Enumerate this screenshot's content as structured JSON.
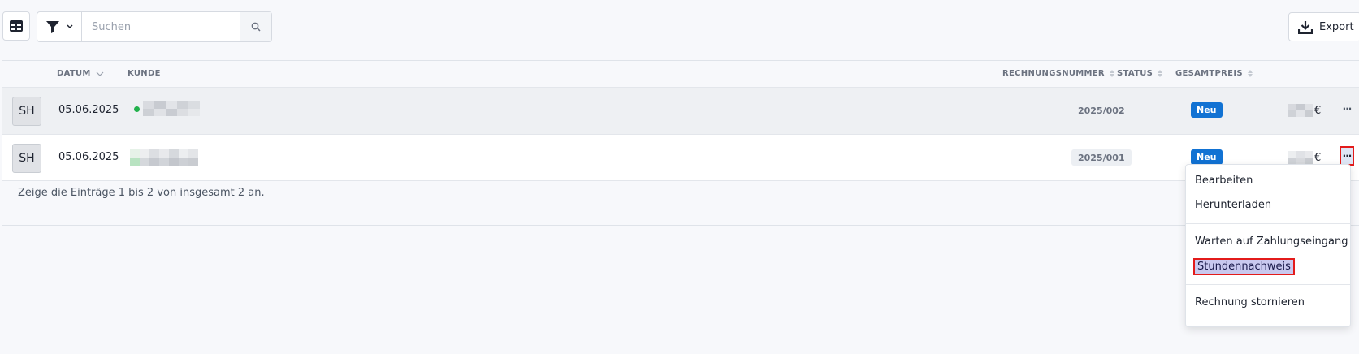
{
  "toolbar": {
    "view_icon": "table-icon",
    "filter_icon": "filter-icon",
    "search_placeholder": "Suchen",
    "search_value": "",
    "search_icon": "search-icon",
    "export_label": "Export",
    "export_icon": "download-icon"
  },
  "table": {
    "columns": [
      {
        "label": "DATUM",
        "sort": "chevron-down-icon"
      },
      {
        "label": "KUNDE"
      },
      {
        "label": "RECHNUNGSNUMMER",
        "sort": "sort-icon"
      },
      {
        "label": "STATUS",
        "sort": "sort-icon"
      },
      {
        "label": "GESAMTPREIS",
        "sort": "sort-icon"
      }
    ],
    "rows": [
      {
        "avatar": "SH",
        "date": "05.06.2025",
        "invoice": "2025/002",
        "status": "Neu",
        "price_suffix": "€",
        "more": "···"
      },
      {
        "avatar": "SH",
        "date": "05.06.2025",
        "invoice": "2025/001",
        "status": "Neu",
        "price_suffix": "€",
        "more": "···"
      }
    ],
    "footer": "Zeige die Einträge 1 bis 2 von insgesamt 2 an."
  },
  "dropdown": {
    "items": [
      "Bearbeiten",
      "Herunterladen",
      "Warten auf Zahlungseingang",
      "Stundennachweis",
      "Rechnung stornieren"
    ]
  },
  "colors": {
    "status_badge": "#1172d3",
    "highlight_border": "#e31b1b",
    "highlight_bg": "#c9c9ef",
    "customer_dot": "#22b14c"
  }
}
